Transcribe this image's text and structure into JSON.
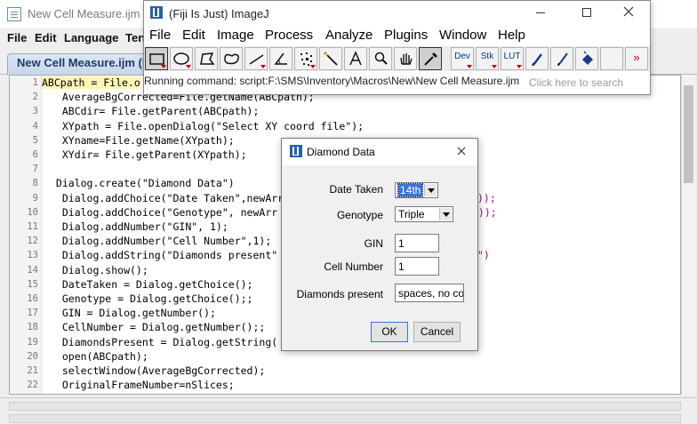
{
  "editor": {
    "title": "New Cell Measure.ijm (R",
    "menus": [
      "File",
      "Edit",
      "Language",
      "Ten"
    ],
    "tab_label": "New Cell Measure.ijm (R",
    "line_numbers": [
      "1",
      "2",
      "3",
      "4",
      "5",
      "6",
      "7",
      "8",
      "9",
      "10",
      "11",
      "12",
      "13",
      "14",
      "15",
      "16",
      "17",
      "18",
      "19",
      "20",
      "21",
      "22"
    ],
    "lines": [
      "ABCpath = File.o",
      "  AverageBgCorrected=File.getName(ABCpath);",
      "  ABCdir= File.getParent(ABCpath);",
      "  XYpath = File.openDialog(\"Select XY coord file\");",
      "  XYname=File.getName(XYpath);",
      "  XYdir= File.getParent(XYpath);",
      "",
      " Dialog.create(\"Diamond Data\")",
      "  Dialog.addChoice(\"Date Taken\",newArr",
      "  Dialog.addChoice(\"Genotype\", newArr",
      "  Dialog.addNumber(\"GIN\", 1);",
      "  Dialog.addNumber(\"Cell Number\",1);",
      "  Dialog.addString(\"Diamonds present\"",
      "  Dialog.show();",
      "  DateTaken = Dialog.getChoice();",
      "  Genotype = Dialog.getChoice();;",
      "  GIN = Dialog.getNumber();",
      "  CellNumber = Dialog.getNumber();;",
      "  DiamondsPresent = Dialog.getString(",
      "  open(ABCpath);",
      "  selectWindow(AverageBgCorrected);",
      "  OriginalFrameNumber=nSlices;"
    ],
    "line_tails": [
      "",
      "",
      "",
      "",
      "",
      "",
      "",
      "",
      "));",
      "\"));",
      "",
      "",
      "\")",
      "",
      "",
      "",
      "",
      "",
      "",
      "",
      "",
      ""
    ]
  },
  "imagej": {
    "title": "(Fiji Is Just) ImageJ",
    "menus": [
      "File",
      "Edit",
      "Image",
      "Process",
      "Analyze",
      "Plugins",
      "Window",
      "Help"
    ],
    "tools": [
      {
        "name": "rectangle-tool",
        "icon": "rectangle-icon"
      },
      {
        "name": "oval-tool",
        "icon": "oval-icon"
      },
      {
        "name": "polygon-tool",
        "icon": "polygon-icon"
      },
      {
        "name": "freehand-tool",
        "icon": "freehand-icon"
      },
      {
        "name": "line-tool",
        "icon": "line-icon"
      },
      {
        "name": "angle-tool",
        "icon": "angle-icon"
      },
      {
        "name": "point-tool",
        "icon": "point-icon"
      },
      {
        "name": "wand-tool",
        "icon": "wand-icon"
      },
      {
        "name": "text-tool",
        "icon": "text-icon"
      },
      {
        "name": "magnifier-tool",
        "icon": "magnifier-icon"
      },
      {
        "name": "scroll-tool",
        "icon": "hand-icon"
      },
      {
        "name": "color-picker-tool",
        "icon": "eyedropper-icon"
      }
    ],
    "tool_text": {
      "dev": "Dev",
      "stk": "Stk",
      "lut": "LUT",
      "more": "»"
    },
    "status": "Running command: script:F:\\SMS\\Inventory\\Macros\\New\\New Cell Measure.ijm",
    "search_hint": "Click here to search"
  },
  "dialog": {
    "title": "Diamond Data",
    "date_label": "Date Taken",
    "date_value": "14th",
    "genotype_label": "Genotype",
    "genotype_value": "Triple",
    "gin_label": "GIN",
    "gin_value": "1",
    "cell_label": "Cell Number",
    "cell_value": "1",
    "diamonds_label": "Diamonds present",
    "diamonds_value": "spaces, no co",
    "ok_label": "OK",
    "cancel_label": "Cancel"
  },
  "colors": {
    "string": "#a000a0",
    "line_highlight": "#fff5b5",
    "selection": "#3874d8",
    "red_indicator": "#c00000"
  }
}
